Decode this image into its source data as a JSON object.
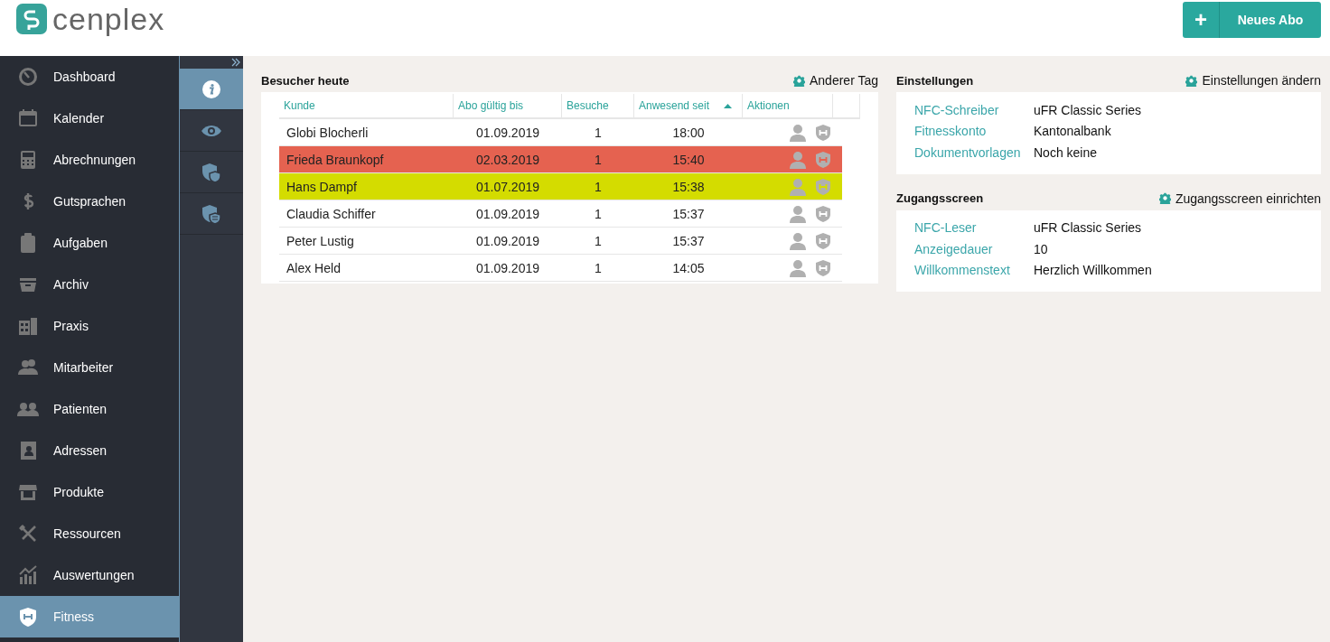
{
  "logo": {
    "text": "cenplex"
  },
  "header": {
    "new_button": {
      "icon": "+",
      "label": "Neues Abo"
    }
  },
  "sidebar": {
    "items": [
      {
        "label": "Dashboard",
        "selected": false
      },
      {
        "label": "Kalender",
        "selected": false
      },
      {
        "label": "Abrechnungen",
        "selected": false
      },
      {
        "label": "Gutsprachen",
        "selected": false
      },
      {
        "label": "Aufgaben",
        "selected": false
      },
      {
        "label": "Archiv",
        "selected": false
      },
      {
        "label": "Praxis",
        "selected": false
      },
      {
        "label": "Mitarbeiter",
        "selected": false
      },
      {
        "label": "Patienten",
        "selected": false
      },
      {
        "label": "Adressen",
        "selected": false
      },
      {
        "label": "Produkte",
        "selected": false
      },
      {
        "label": "Ressourcen",
        "selected": false
      },
      {
        "label": "Auswertungen",
        "selected": false
      },
      {
        "label": "Fitness",
        "selected": true
      }
    ]
  },
  "subnav": {
    "items": [
      {
        "selected": true
      },
      {
        "selected": false
      },
      {
        "selected": false
      },
      {
        "selected": false
      }
    ]
  },
  "visitors": {
    "title": "Besucher heute",
    "action": "Anderer Tag",
    "columns": [
      {
        "label": "Kunde",
        "sorted": false
      },
      {
        "label": "Abo gültig bis",
        "sorted": false
      },
      {
        "label": "Besuche",
        "sorted": false
      },
      {
        "label": "Anwesend seit",
        "sorted": true
      },
      {
        "label": "Aktionen",
        "sorted": false
      }
    ],
    "rows": [
      {
        "name": "Globi Blocherli",
        "valid_until": "01.09.2019",
        "visits": "1",
        "since": "18:00",
        "color": "#ffffff"
      },
      {
        "name": "Frieda Braunkopf",
        "valid_until": "02.03.2019",
        "visits": "1",
        "since": "15:40",
        "color": "#e56250"
      },
      {
        "name": "Hans Dampf",
        "valid_until": "01.07.2019",
        "visits": "1",
        "since": "15:38",
        "color": "#d4dc00"
      },
      {
        "name": "Claudia Schiffer",
        "valid_until": "01.09.2019",
        "visits": "1",
        "since": "15:37",
        "color": "#ffffff"
      },
      {
        "name": "Peter Lustig",
        "valid_until": "01.09.2019",
        "visits": "1",
        "since": "15:37",
        "color": "#ffffff"
      },
      {
        "name": "Alex Held",
        "valid_until": "01.09.2019",
        "visits": "1",
        "since": "14:05",
        "color": "#ffffff"
      }
    ]
  },
  "settings": {
    "title": "Einstellungen",
    "action": "Einstellungen ändern",
    "fields": [
      {
        "label": "NFC-Schreiber",
        "value": "uFR Classic Series"
      },
      {
        "label": "Fitnesskonto",
        "value": "Kantonalbank"
      },
      {
        "label": "Dokumentvorlagen",
        "value": "Noch keine"
      }
    ]
  },
  "access_screen": {
    "title": "Zugangsscreen",
    "action": "Zugangsscreen einrichten",
    "fields": [
      {
        "label": "NFC-Leser",
        "value": "uFR Classic Series"
      },
      {
        "label": "Anzeigedauer",
        "value": "10"
      },
      {
        "label": "Willkommenstext",
        "value": "Herzlich Willkommen"
      }
    ]
  }
}
